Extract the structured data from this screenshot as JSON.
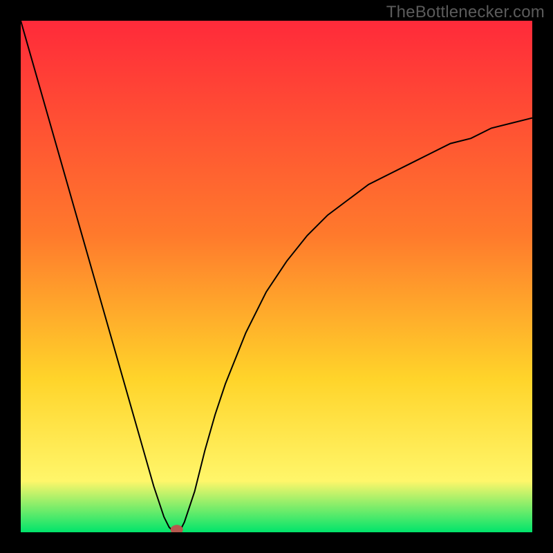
{
  "watermark": "TheBottlenecker.com",
  "colors": {
    "frame": "#000000",
    "gradient_top": "#ff2a3a",
    "gradient_mid1": "#ff7a2c",
    "gradient_mid2": "#ffd42a",
    "gradient_mid3": "#fff66a",
    "gradient_bottom": "#00e46b",
    "curve": "#000000",
    "marker": "#b6584e"
  },
  "chart_data": {
    "type": "line",
    "title": "",
    "xlabel": "",
    "ylabel": "",
    "xlim": [
      0,
      100
    ],
    "ylim": [
      0,
      100
    ],
    "x": [
      0,
      2,
      4,
      6,
      8,
      10,
      12,
      14,
      16,
      18,
      20,
      22,
      24,
      26,
      28,
      29,
      30,
      31,
      32,
      34,
      36,
      38,
      40,
      44,
      48,
      52,
      56,
      60,
      64,
      68,
      72,
      76,
      80,
      84,
      88,
      92,
      96,
      100
    ],
    "values": [
      100,
      93,
      86,
      79,
      72,
      65,
      58,
      51,
      44,
      37,
      30,
      23,
      16,
      9,
      3,
      1,
      0,
      0,
      2,
      8,
      16,
      23,
      29,
      39,
      47,
      53,
      58,
      62,
      65,
      68,
      70,
      72,
      74,
      76,
      77,
      79,
      80,
      81
    ],
    "marker": {
      "x": 30.5,
      "y": 0.5
    },
    "annotations": []
  }
}
